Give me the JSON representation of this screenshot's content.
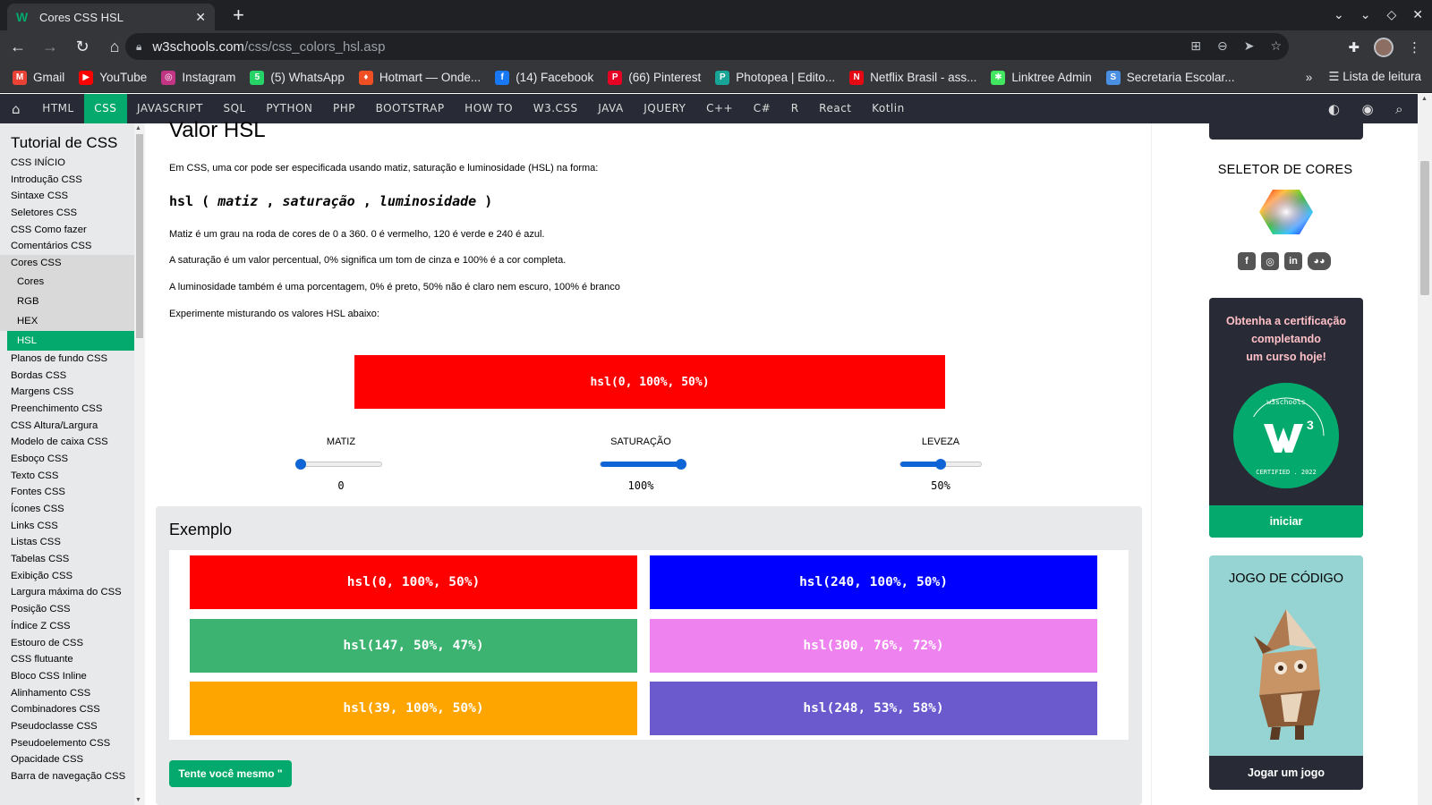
{
  "browser": {
    "tab_title": "Cores CSS HSL",
    "tab_favicon": "W",
    "url_domain": "w3schools.com",
    "url_path": "/css/css_colors_hsl.asp",
    "bookmarks": [
      {
        "label": "Gmail",
        "icon": "gmail-icon",
        "color": "#ea4335",
        "glyph": "M"
      },
      {
        "label": "YouTube",
        "icon": "youtube-icon",
        "color": "#ff0000",
        "glyph": "▶"
      },
      {
        "label": "Instagram",
        "icon": "instagram-icon",
        "color": "#c13584",
        "glyph": "◎"
      },
      {
        "label": "(5) WhatsApp",
        "icon": "whatsapp-icon",
        "color": "#25d366",
        "glyph": "5"
      },
      {
        "label": "Hotmart — Onde...",
        "icon": "hotmart-icon",
        "color": "#f04e23",
        "glyph": "♦"
      },
      {
        "label": "(14) Facebook",
        "icon": "facebook-icon",
        "color": "#1877f2",
        "glyph": "f"
      },
      {
        "label": "(66) Pinterest",
        "icon": "pinterest-icon",
        "color": "#e60023",
        "glyph": "P"
      },
      {
        "label": "Photopea | Edito...",
        "icon": "photopea-icon",
        "color": "#18a497",
        "glyph": "P"
      },
      {
        "label": "Netflix Brasil - ass...",
        "icon": "netflix-icon",
        "color": "#e50914",
        "glyph": "N"
      },
      {
        "label": "Linktree Admin",
        "icon": "linktree-icon",
        "color": "#43e660",
        "glyph": "✱"
      },
      {
        "label": "Secretaria Escolar...",
        "icon": "secretaria-icon",
        "color": "#4a90e2",
        "glyph": "S"
      }
    ],
    "reading_list": "Lista de leitura"
  },
  "topnav": {
    "items": [
      "HTML",
      "CSS",
      "JAVASCRIPT",
      "SQL",
      "PYTHON",
      "PHP",
      "BOOTSTRAP",
      "HOW TO",
      "W3.CSS",
      "JAVA",
      "JQUERY",
      "C++",
      "C#",
      "R",
      "React",
      "Kotlin"
    ],
    "active": "CSS"
  },
  "sidebar": {
    "title": "Tutorial de CSS",
    "items_before": [
      "CSS INÍCIO",
      "Introdução CSS",
      "Sintaxe CSS",
      "Seletores CSS",
      "CSS Como fazer",
      "Comentários CSS"
    ],
    "current": "Cores CSS",
    "subitems": [
      "Cores",
      "RGB",
      "HEX",
      "HSL"
    ],
    "active_sub": "HSL",
    "items_after": [
      "Planos de fundo CSS",
      "Bordas CSS",
      "Margens CSS",
      "Preenchimento CSS",
      "CSS Altura/Largura",
      "Modelo de caixa CSS",
      "Esboço CSS",
      "Texto CSS",
      "Fontes CSS",
      "Ícones CSS",
      "Links CSS",
      "Listas CSS",
      "Tabelas CSS",
      "Exibição CSS",
      "Largura máxima do CSS",
      "Posição CSS",
      "Índice Z CSS",
      "Estouro de CSS",
      "CSS flutuante",
      "Bloco CSS Inline",
      "Alinhamento CSS",
      "Combinadores CSS",
      "Pseudoclasse CSS",
      "Pseudoelemento CSS",
      "Opacidade CSS",
      "Barra de navegação CSS"
    ]
  },
  "main": {
    "heading": "Valor HSL",
    "intro": "Em CSS, uma cor pode ser especificada usando matiz, saturação e luminosidade (HSL) na forma:",
    "syntax": {
      "fn": "hsl",
      "open": "(",
      "a": "matiz",
      "sep1": ",",
      "b": "saturação",
      "sep2": ",",
      "c": "luminosidade",
      "close": ")"
    },
    "p_hue": "Matiz é um grau na roda de cores de 0 a 360. 0 é vermelho, 120 é verde e 240 é azul.",
    "p_sat": "A saturação é um valor percentual, 0% significa um tom de cinza e 100% é a cor completa.",
    "p_light": "A luminosidade também é uma porcentagem, 0% é preto, 50% não é claro nem escuro, 100% é branco",
    "p_try": "Experimente misturando os valores HSL abaixo:",
    "preview": {
      "label": "hsl(0, 100%, 50%)",
      "color": "#ff0000"
    },
    "sliders": [
      {
        "label": "MATIZ",
        "value": "0",
        "fraction": 0.0
      },
      {
        "label": "SATURAÇÃO",
        "value": "100%",
        "fraction": 1.0
      },
      {
        "label": "LEVEZA",
        "value": "50%",
        "fraction": 0.5
      }
    ],
    "example": {
      "heading": "Exemplo",
      "swatches": [
        {
          "label": "hsl(0, 100%, 50%)",
          "color": "#ff0000"
        },
        {
          "label": "hsl(240, 100%, 50%)",
          "color": "#0000ff"
        },
        {
          "label": "hsl(147, 50%, 47%)",
          "color": "#3cb371"
        },
        {
          "label": "hsl(300, 76%, 72%)",
          "color": "#ee82ee"
        },
        {
          "label": "hsl(39, 100%, 50%)",
          "color": "#ffa500"
        },
        {
          "label": "hsl(248, 53%, 58%)",
          "color": "#6a5acd"
        }
      ],
      "button": "Tente você mesmo \""
    }
  },
  "right": {
    "color_picker_title": "SELETOR DE CORES",
    "cert_text_lines": [
      "Obtenha a certificação",
      "completando",
      "um curso hoje!"
    ],
    "cert_badge_top": "w3schools",
    "cert_badge_bottom": "CERTIFIED . 2022",
    "cert_button": "iniciar",
    "game_title": "JOGO DE CÓDIGO",
    "game_button": "Jogar um jogo"
  },
  "colors": {
    "accent": "#04aa6d",
    "nav_dark": "#282a35",
    "sidebar_bg": "#e7e9eb"
  }
}
